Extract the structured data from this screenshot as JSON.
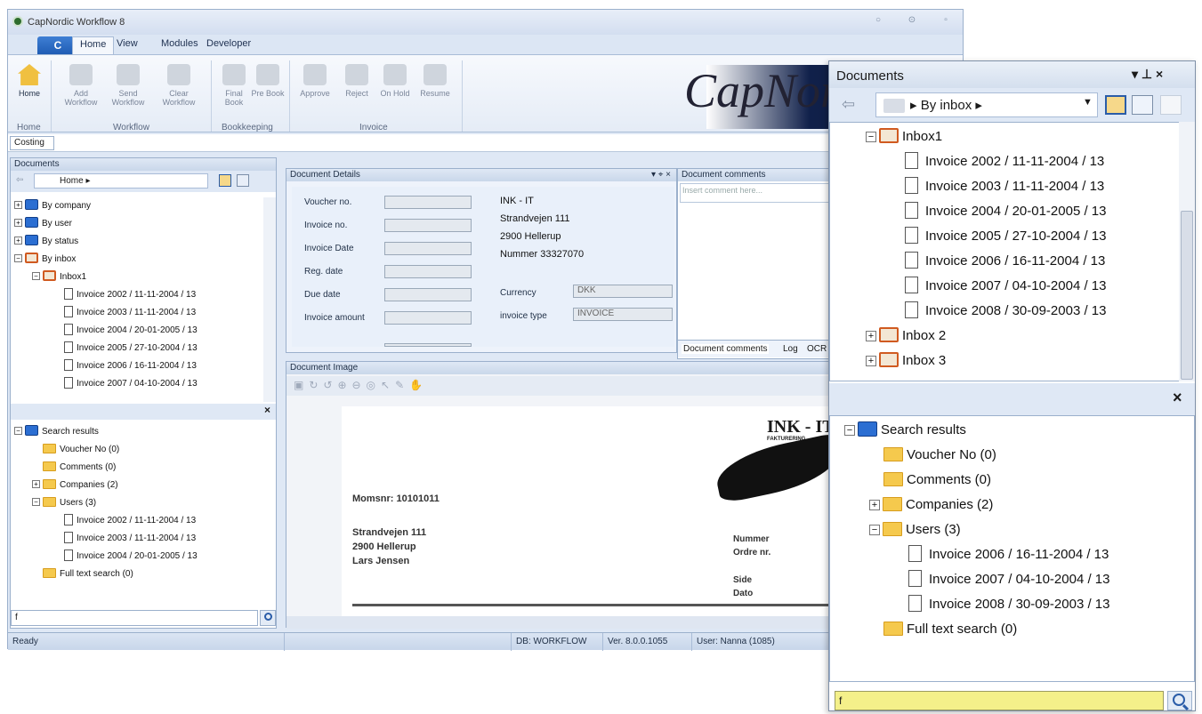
{
  "app": {
    "title": "CapNordic Workflow 8",
    "brand": "CapNordic"
  },
  "ribbon": {
    "app_button": "C",
    "tabs": [
      "Home",
      "View",
      "Modules",
      "Developer"
    ],
    "groups": [
      {
        "name": "Home",
        "buttons": [
          "Home"
        ]
      },
      {
        "name": "Workflow",
        "buttons": [
          "Add Workflow",
          "Send Workflow",
          "Clear Workflow"
        ]
      },
      {
        "name": "Bookkeeping",
        "buttons": [
          "Final Book",
          "Pre Book"
        ]
      },
      {
        "name": "Invoice",
        "buttons": [
          "Approve",
          "Reject",
          "On Hold",
          "Resume"
        ]
      }
    ],
    "costing": "Costing"
  },
  "left_panel": {
    "title": "Documents",
    "nav": "Home",
    "tree": [
      "By company",
      "By user",
      "By status",
      "By inbox",
      "Inbox1",
      "Invoice 2002 / 11-11-2004 / 13",
      "Invoice 2003 / 11-11-2004 / 13",
      "Invoice 2004 / 20-01-2005 / 13",
      "Invoice 2005 / 27-10-2004 / 13",
      "Invoice 2006 / 16-11-2004 / 13",
      "Invoice 2007 / 04-10-2004 / 13"
    ],
    "search_tree": [
      "Search results",
      "Voucher No (0)",
      "Comments (0)",
      "Companies (2)",
      "Users (3)",
      "Invoice 2002 / 11-11-2004 / 13",
      "Invoice 2003 / 11-11-2004 / 13",
      "Invoice 2004 / 20-01-2005 / 13",
      "Full text search (0)"
    ],
    "search_value": "f"
  },
  "details": {
    "title": "Document Details",
    "labels": [
      "Voucher no.",
      "Invoice no.",
      "Invoice Date",
      "Reg. date",
      "Due date",
      "Invoice amount"
    ],
    "address": [
      "INK - IT",
      "Strandvejen 111",
      "2900 Hellerup",
      "Nummer 33327070"
    ],
    "currency_label": "Currency",
    "currency_value": "DKK",
    "type_label": "invoice type",
    "type_value": "INVOICE"
  },
  "comments": {
    "title": "Document comments",
    "placeholder": "Insert comment here...",
    "tabs": [
      "Document comments",
      "Log",
      "OCR"
    ]
  },
  "image": {
    "title": "Document Image",
    "company": "INK - IT",
    "company_sub": "FAKTURERING",
    "momsnr": "Momsnr: 10101011",
    "address": [
      "Strandvejen 111",
      "2900 Hellerup",
      "Lars Jensen"
    ],
    "right_labels": [
      "Nummer",
      "Ordre nr.",
      "Side",
      "Dato"
    ]
  },
  "status": {
    "ready": "Ready",
    "db": "DB: WORKFLOW",
    "ver": "Ver. 8.0.0.1055",
    "user": "User: Nanna (1085)"
  },
  "zoom": {
    "title": "Documents",
    "nav": "By inbox",
    "tree": [
      {
        "label": "Inbox1",
        "kind": "inbox",
        "indent": 0,
        "pm": "-"
      },
      {
        "label": "Invoice 2002 / 11-11-2004 / 13",
        "kind": "doc",
        "indent": 1
      },
      {
        "label": "Invoice 2003 / 11-11-2004 / 13",
        "kind": "doc",
        "indent": 1
      },
      {
        "label": "Invoice 2004 / 20-01-2005 / 13",
        "kind": "doc",
        "indent": 1
      },
      {
        "label": "Invoice 2005 / 27-10-2004 / 13",
        "kind": "doc",
        "indent": 1
      },
      {
        "label": "Invoice 2006 / 16-11-2004 / 13",
        "kind": "doc",
        "indent": 1
      },
      {
        "label": "Invoice 2007 / 04-10-2004 / 13",
        "kind": "doc",
        "indent": 1
      },
      {
        "label": "Invoice 2008 / 30-09-2003 / 13",
        "kind": "doc",
        "indent": 1
      },
      {
        "label": "Inbox 2",
        "kind": "inbox",
        "indent": 0,
        "pm": "+"
      },
      {
        "label": "Inbox 3",
        "kind": "inbox",
        "indent": 0,
        "pm": "+"
      }
    ],
    "search": [
      {
        "label": "Search results",
        "kind": "bstack",
        "indent": 0,
        "pm": "-"
      },
      {
        "label": "Voucher No (0)",
        "kind": "fold",
        "indent": 1
      },
      {
        "label": "Comments (0)",
        "kind": "fold",
        "indent": 1
      },
      {
        "label": "Companies (2)",
        "kind": "fold",
        "indent": 1,
        "pm": "+"
      },
      {
        "label": "Users (3)",
        "kind": "fold",
        "indent": 1,
        "pm": "-"
      },
      {
        "label": "Invoice 2006 / 16-11-2004 / 13",
        "kind": "doc",
        "indent": 2
      },
      {
        "label": "Invoice 2007 / 04-10-2004 / 13",
        "kind": "doc",
        "indent": 2
      },
      {
        "label": "Invoice 2008 / 30-09-2003 / 13",
        "kind": "doc",
        "indent": 2
      },
      {
        "label": "Full text search (0)",
        "kind": "fold",
        "indent": 1
      }
    ],
    "search_value": "f"
  }
}
